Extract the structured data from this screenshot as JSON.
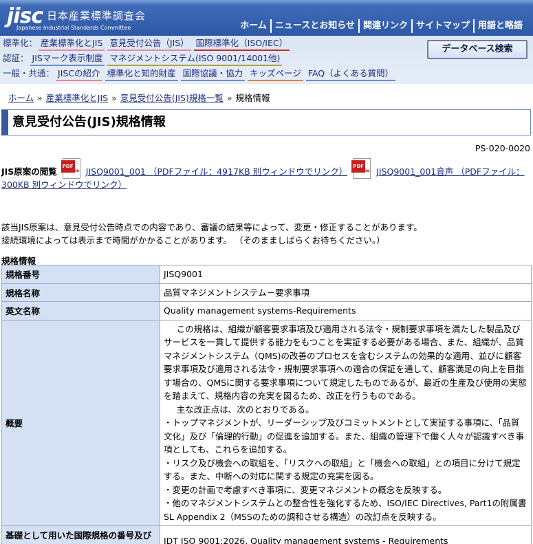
{
  "header": {
    "logo_mark": "jisc",
    "logo_ja": "日本産業標準調査会",
    "logo_en": "Japanese Industrial Standards Committee",
    "top_nav": [
      "ホーム",
      "ニュースとお知らせ",
      "関連リンク",
      "サイトマップ",
      "用語と略語"
    ],
    "rows": [
      {
        "category": "標準化：",
        "links": [
          "産業標準化とJIS",
          "意見受付公告（JIS）",
          "国際標準化（ISO/IEC）"
        ]
      },
      {
        "category": "認証：",
        "links": [
          "JISマーク表示制度",
          "マネジメントシステム(ISO 9001/14001他)"
        ]
      },
      {
        "category": "一般・共通：",
        "links": [
          "JISCの紹介",
          "標準化と知的財産",
          "国際協議・協力",
          "キッズページ",
          "FAQ（よくある質問）"
        ]
      }
    ],
    "db_search": "データベース検索"
  },
  "breadcrumb": [
    "ホーム",
    "産業標準化とJIS",
    "意見受付公告(JIS)規格一覧",
    "規格情報"
  ],
  "page_title": "意見受付公告(JIS)規格情報",
  "page_id": "PS-020-0020",
  "jis_view": {
    "label": "JIS原案の閲覧",
    "pdf_tag": "PDF",
    "adobe": "Adobe",
    "link1": "JISQ9001_001 （PDFファイル：4917KB 別ウィンドウでリンク）",
    "link2": "JISQ9001_001音声 （PDFファイル：300KB 別ウィンドウでリンク）"
  },
  "notes": [
    "該当JIS原案は、意見受付公告時点での内容であり、審議の結果等によって、変更・修正することがあります。",
    "接続環境によっては表示まで時間がかかることがあります。 （そのまましばらくお待ちください。）"
  ],
  "table_heading": "規格情報",
  "table": {
    "rows": [
      {
        "label": "規格番号",
        "value": "JISQ9001"
      },
      {
        "label": "規格名称",
        "value": "品質マネジメントシステム－要求事項"
      },
      {
        "label": "英文名称",
        "value": "Quality management systems-Requirements"
      }
    ],
    "summary_label": "概要",
    "summary_lines": [
      "この規格は、組織が顧客要求事項及び適用される法令・規制要求事項を満たした製品及びサービスを一貫して提供する能力をもつことを実証する必要がある場合、また、組織が、品質マネジメントシステム（QMS)の改善のプロセスを含むシステムの効果的な適用、並びに顧客要求事項及び適用される法令・規制要求事項への適合の保証を通して、顧客満足の向上を目指す場合の、QMSに関する要求事項について規定したものであるが、最近の生産及び使用の実態を踏まえて、規格内容の充実を図るため、改正を行うものである。",
      "主な改正点は、次のとおりである。",
      "・トップマネジメントが、リーダーシップ及びコミットメントとして実証する事項に、「品質文化」及び「倫理的行動」の促進を追加する。また、組織の管理下で働く人々が認識すべき事項としても、これらを追加する。",
      "・リスク及び機会への取組を、「リスクへの取組」と「機会への取組」との項目に分けて規定する。また、中断への対応に関する規定の充実を図る。",
      "・変更の計画で考慮すべき事項に、変更マネジメントの概念を反映する。",
      "・他のマネジメントシステムとの整合性を強化するため、ISO/IEC Directives, Part1の附属書SL Appendix 2（MSSのための調和させる構造）の改訂点を反映する。"
    ],
    "basis_label": "基礎として用いた国際規格の番号及び同等性記号",
    "basis_value": "IDT ISO 9001:2026, Quality management systems - Requirements"
  }
}
